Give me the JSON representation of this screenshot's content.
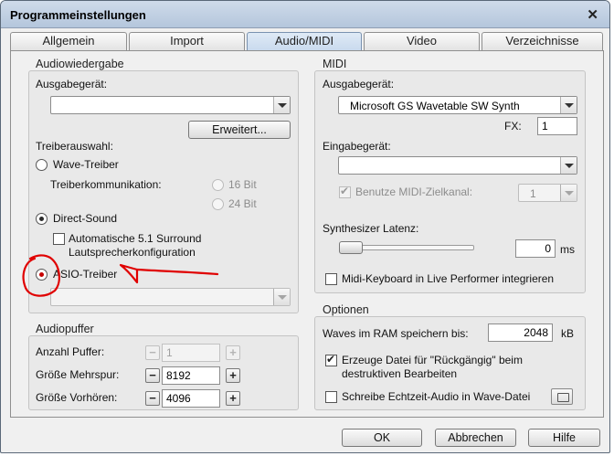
{
  "window": {
    "title": "Programmeinstellungen",
    "close_glyph": "✕"
  },
  "tabs": [
    "Allgemein",
    "Import",
    "Audio/MIDI",
    "Video",
    "Verzeichnisse"
  ],
  "audio": {
    "title": "Audiowiedergabe",
    "output_label": "Ausgabegerät:",
    "output_value": "",
    "advanced_button": "Erweitert...",
    "driver_label": "Treiberauswahl:",
    "wave_driver": "Wave-Treiber",
    "driver_comm_label": "Treiberkommunikation:",
    "bit16": "16 Bit",
    "bit24": "24 Bit",
    "direct_sound": "Direct-Sound",
    "surround_line1": "Automatische 5.1 Surround",
    "surround_line2": "Lautsprecherkonfiguration",
    "asio_driver": "ASIO-Treiber",
    "asio_value": ""
  },
  "buffer": {
    "title": "Audiopuffer",
    "count_label": "Anzahl Puffer:",
    "count_value": "1",
    "multitrack_label": "Größe Mehrspur:",
    "multitrack_value": "8192",
    "preview_label": "Größe Vorhören:",
    "preview_value": "4096",
    "minus": "−",
    "plus": "+"
  },
  "midi": {
    "title": "MIDI",
    "output_label": "Ausgabegerät:",
    "output_value": "Microsoft GS Wavetable SW Synth",
    "fx_label": "FX:",
    "fx_value": "1",
    "input_label": "Eingabegerät:",
    "input_value": "",
    "target_channel_label": "Benutze MIDI-Zielkanal:",
    "target_channel_value": "1",
    "latency_label": "Synthesizer Latenz:",
    "latency_value": "0",
    "latency_unit": "ms",
    "latency_level": 0,
    "keyboard_label": "Midi-Keyboard in Live Performer integrieren",
    "check_glyph": "✔"
  },
  "options": {
    "title": "Optionen",
    "waves_label": "Waves im RAM speichern bis:",
    "waves_value": "2048",
    "waves_unit": "kB",
    "undo_line1": "Erzeuge Datei für \"Rückgängig\" beim",
    "undo_line2": "destruktiven Bearbeiten",
    "realtime_label": "Schreibe Echtzeit-Audio in Wave-Datei"
  },
  "buttons": {
    "ok": "OK",
    "cancel": "Abbrechen",
    "help": "Hilfe"
  },
  "colors": {
    "annotation": "#e00000",
    "active_tab": "#c9daee",
    "titlebar": "#b4c6dc"
  }
}
